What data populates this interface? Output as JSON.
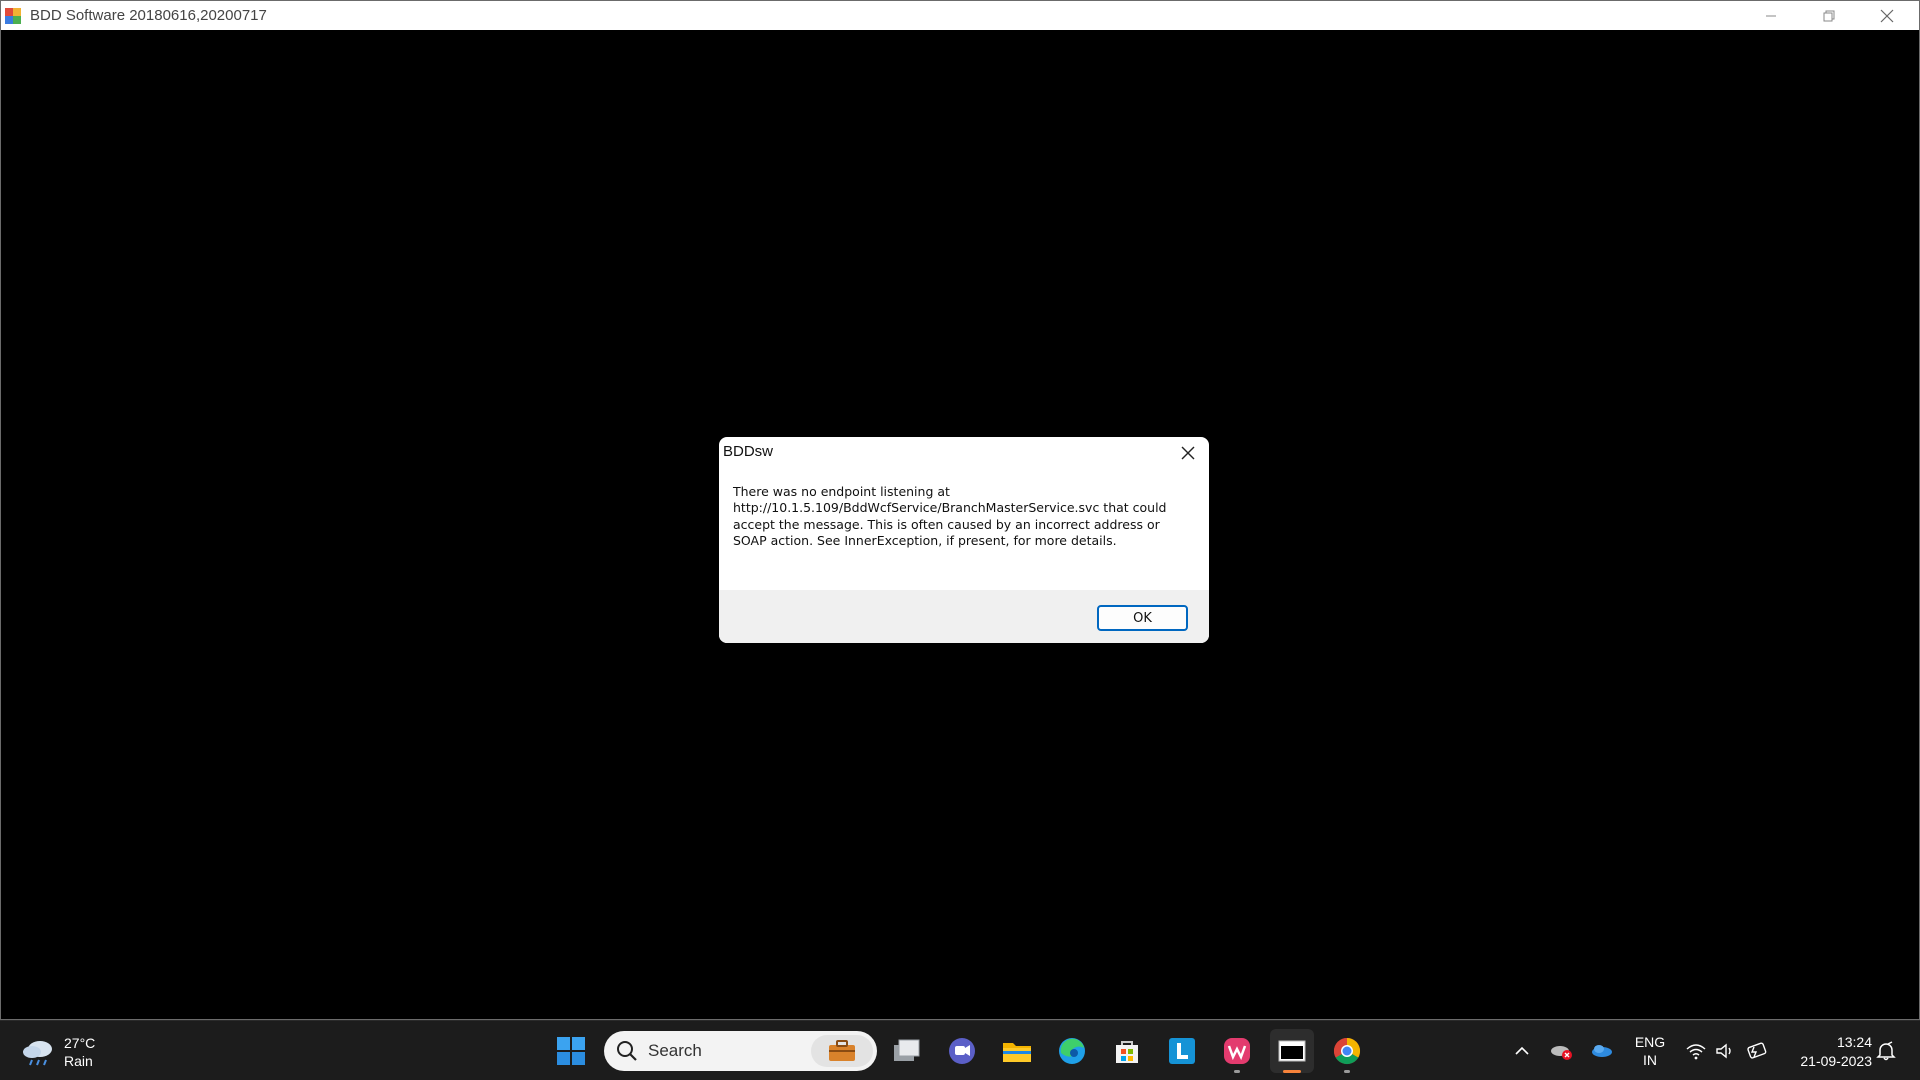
{
  "window": {
    "title": "BDD Software 20180616,20200717"
  },
  "dialog": {
    "title": "BDDsw",
    "message": "There was no endpoint listening at http://10.1.5.109/BddWcfService/BranchMasterService.svc that could accept the message. This is often caused by an incorrect address or SOAP action. See InnerException, if present, for more details.",
    "ok_label": "OK"
  },
  "taskbar": {
    "weather": {
      "temp": "27°C",
      "condition": "Rain",
      "icon": "cloud-rain-icon"
    },
    "search": {
      "label": "Search",
      "badge_icon": "briefcase-icon"
    },
    "apps": [
      {
        "name": "start-menu-icon"
      },
      {
        "name": "task-view-icon"
      },
      {
        "name": "teams-chat-icon"
      },
      {
        "name": "file-explorer-icon"
      },
      {
        "name": "edge-browser-icon"
      },
      {
        "name": "microsoft-store-icon"
      },
      {
        "name": "l-app-icon"
      },
      {
        "name": "wps-office-icon"
      },
      {
        "name": "bdd-software-window-icon"
      },
      {
        "name": "chrome-icon"
      }
    ],
    "tray": {
      "icons": [
        "show-hidden-icons-chevron",
        "onedrive-error-icon",
        "onedrive-icon",
        "wifi-icon",
        "volume-icon",
        "battery-charging-icon"
      ],
      "lang_line1": "ENG",
      "lang_line2": "IN",
      "time": "13:24",
      "date": "21-09-2023",
      "notification_icon": "notification-bell-icon"
    }
  },
  "colors": {
    "accent": "#0067c0",
    "taskbar_bg": "#1c1c1c",
    "active_indicator": "#f7833b"
  }
}
